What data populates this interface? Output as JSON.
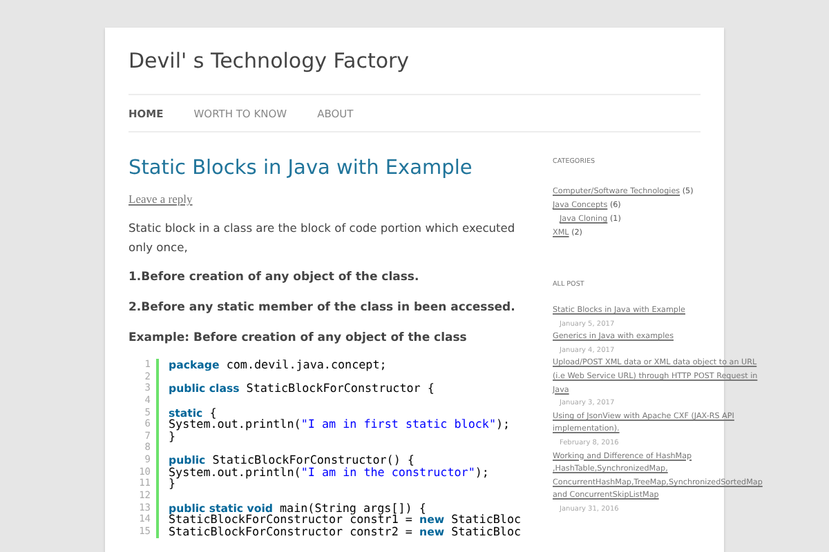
{
  "site_title": "Devil' s Technology Factory",
  "nav": [
    {
      "label": "HOME",
      "selected": true
    },
    {
      "label": "WORTH TO KNOW",
      "selected": false
    },
    {
      "label": "ABOUT",
      "selected": false
    }
  ],
  "post": {
    "title": "Static Blocks in Java with Example",
    "reply_link": "Leave a reply",
    "paragraphs": [
      {
        "kind": "normal",
        "text": "Static block in a class are the block of code portion which  executed only once,"
      },
      {
        "kind": "bold",
        "text": "1.Before creation of any object of the class."
      },
      {
        "kind": "bold",
        "text": "2.Before any static member of the class in been accessed."
      },
      {
        "kind": "bold",
        "text": "Example: Before creation of any object of the class"
      }
    ],
    "code": [
      {
        "number": "1",
        "tokens": [
          {
            "kind": "keyword",
            "text": "package"
          },
          {
            "kind": "plain",
            "text": " com.devil.java.concept;"
          }
        ]
      },
      {
        "number": "2"
      },
      {
        "number": "3",
        "tokens": [
          {
            "kind": "keyword",
            "text": "public class"
          },
          {
            "kind": "plain",
            "text": " StaticBlockForConstructor {"
          }
        ]
      },
      {
        "number": "4"
      },
      {
        "number": "5",
        "tokens": [
          {
            "kind": "keyword",
            "text": "static"
          },
          {
            "kind": "plain",
            "text": " {"
          }
        ]
      },
      {
        "number": "6",
        "tokens": [
          {
            "kind": "plain",
            "text": "System.out.println("
          },
          {
            "kind": "string",
            "text": "\"I am in first static block\""
          },
          {
            "kind": "plain",
            "text": ");"
          }
        ]
      },
      {
        "number": "7",
        "tokens": [
          {
            "kind": "plain",
            "text": "}"
          }
        ]
      },
      {
        "number": "8"
      },
      {
        "number": "9",
        "tokens": [
          {
            "kind": "keyword",
            "text": "public"
          },
          {
            "kind": "plain",
            "text": " StaticBlockForConstructor() {"
          }
        ]
      },
      {
        "number": "10",
        "tokens": [
          {
            "kind": "plain",
            "text": "System.out.println("
          },
          {
            "kind": "string",
            "text": "\"I am in the constructor\""
          },
          {
            "kind": "plain",
            "text": ");"
          }
        ]
      },
      {
        "number": "11",
        "tokens": [
          {
            "kind": "plain",
            "text": "}"
          }
        ]
      },
      {
        "number": "12"
      },
      {
        "number": "13",
        "tokens": [
          {
            "kind": "keyword",
            "text": "public static void"
          },
          {
            "kind": "plain",
            "text": " main(String args[]) {"
          }
        ]
      },
      {
        "number": "14",
        "tokens": [
          {
            "kind": "plain",
            "text": "StaticBlockForConstructor constr1 = "
          },
          {
            "kind": "keyword",
            "text": "new"
          },
          {
            "kind": "plain",
            "text": " StaticBloc"
          }
        ]
      },
      {
        "number": "15",
        "tokens": [
          {
            "kind": "plain",
            "text": "StaticBlockForConstructor constr2 = "
          },
          {
            "kind": "keyword",
            "text": "new"
          },
          {
            "kind": "plain",
            "text": " StaticBloc"
          }
        ]
      }
    ]
  },
  "sidebar": {
    "categories": {
      "heading": "CATEGORIES",
      "items": [
        {
          "label": "Computer/Software Technologies",
          "count": "(5)"
        },
        {
          "label": "Java Concepts",
          "count": "(6)",
          "children": [
            {
              "label": "Java Cloning",
              "count": "(1)"
            }
          ]
        },
        {
          "label": "XML",
          "count": "(2)"
        }
      ]
    },
    "all_post": {
      "heading": "ALL POST",
      "items": [
        {
          "title": "Static Blocks in Java with Example",
          "date": "January 5, 2017"
        },
        {
          "title": "Generics in Java with examples",
          "date": "January 4, 2017"
        },
        {
          "title": "Upload/POST XML data or XML data object to an URL (i.e Web Service URL) through HTTP POST Request in Java",
          "date": "January 3, 2017"
        },
        {
          "title": "Using of JsonView with Apache CXF (JAX-RS API implementation).",
          "date": "February 8, 2016"
        },
        {
          "title": "Working and Difference of HashMap ,HashTable,SynchronizedMap, ConcurrentHashMap,TreeMap,SynchronizedSortedMap and ConcurrentSkipListMap",
          "date": "January 31, 2016"
        }
      ]
    }
  }
}
